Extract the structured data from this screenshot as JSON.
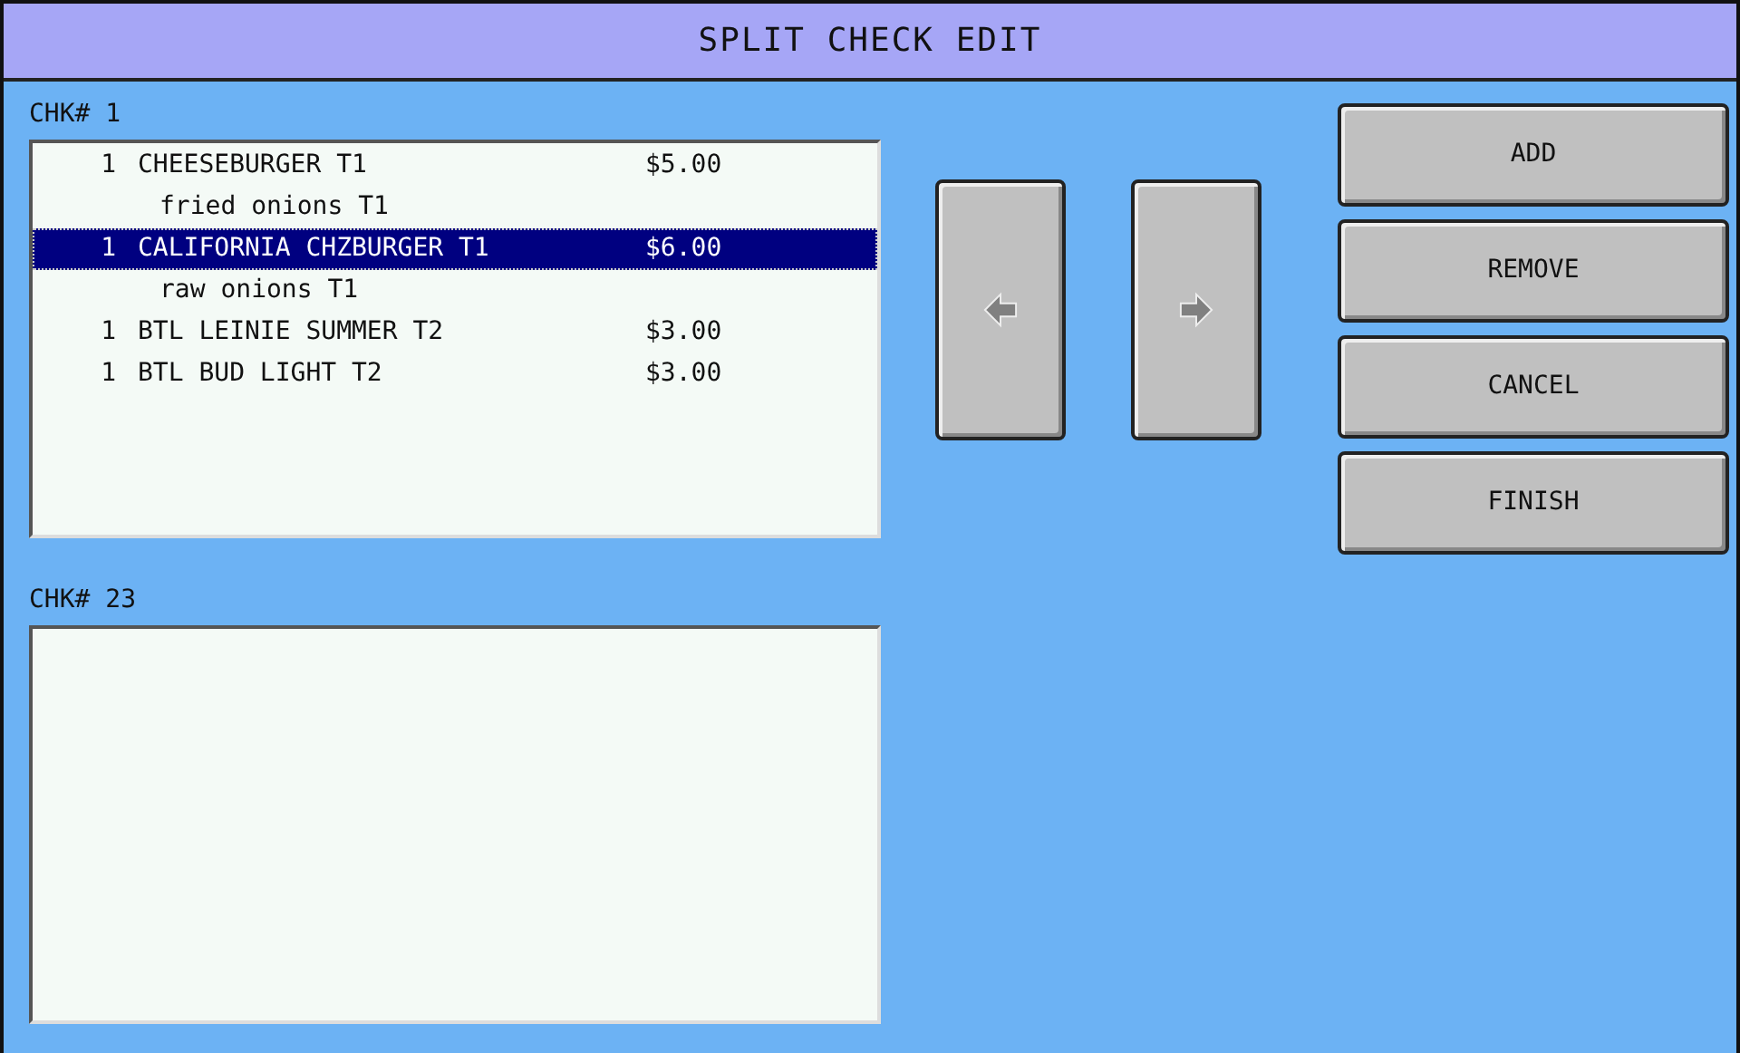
{
  "window": {
    "title": "SPLIT CHECK EDIT"
  },
  "checks": [
    {
      "label": "CHK# 1",
      "rows": [
        {
          "kind": "item",
          "qty": "1",
          "name": "CHEESEBURGER T1",
          "price": "$5.00",
          "selected": false
        },
        {
          "kind": "modifier",
          "name": "fried onions T1",
          "selected": false
        },
        {
          "kind": "item",
          "qty": "1",
          "name": "CALIFORNIA CHZBURGER T1",
          "price": "$6.00",
          "selected": true
        },
        {
          "kind": "modifier",
          "name": "raw onions T1",
          "selected": false
        },
        {
          "kind": "item",
          "qty": "1",
          "name": "BTL LEINIE SUMMER T2",
          "price": "$3.00",
          "selected": false
        },
        {
          "kind": "item",
          "qty": "1",
          "name": "BTL BUD LIGHT T2",
          "price": "$3.00",
          "selected": false
        }
      ]
    },
    {
      "label": "CHK# 23"
    }
  ],
  "move_buttons": [
    {
      "kind": "left"
    },
    {
      "kind": "right"
    }
  ],
  "buttons": [
    "ADD",
    "REMOVE",
    "CANCEL",
    "FINISH"
  ]
}
